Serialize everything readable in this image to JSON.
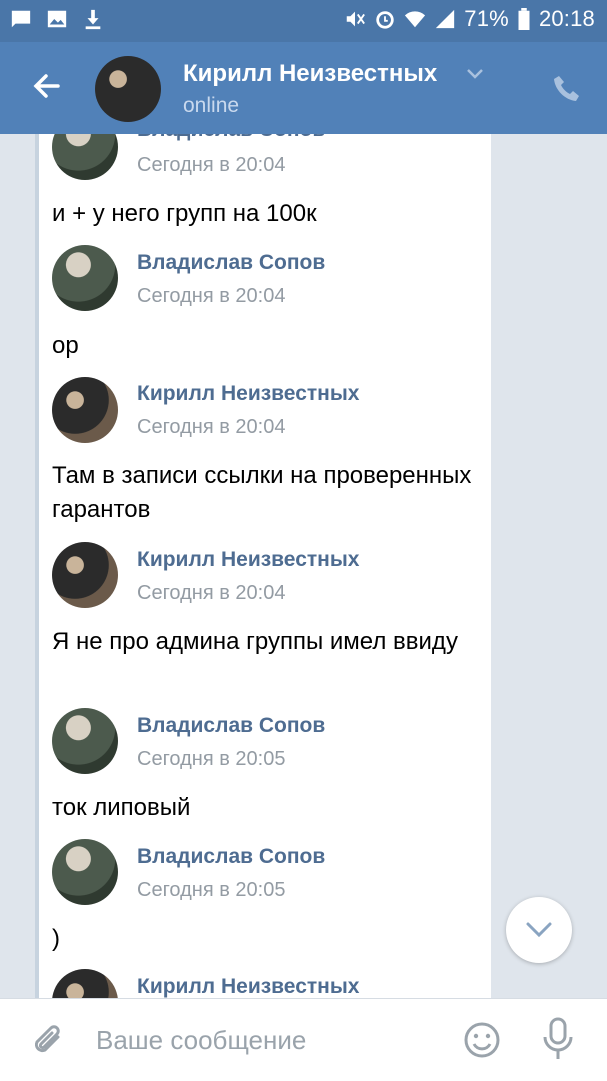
{
  "statusbar": {
    "battery_percent": "71%",
    "time": "20:18",
    "icons_left": [
      "message-icon",
      "image-icon",
      "download-icon"
    ],
    "icons_right": [
      "mute-icon",
      "alarm-icon",
      "wifi-icon",
      "signal-icon",
      "battery-icon"
    ]
  },
  "header": {
    "contact_name": "Кирилл Неизвестных",
    "status": "online"
  },
  "messages": [
    {
      "author": "Владислав Сопов",
      "time": "Сегодня в 20:04",
      "text": "и + у него групп на 100к"
    },
    {
      "author": "Владислав Сопов",
      "time": "Сегодня в 20:04",
      "text": "ор"
    },
    {
      "author": "Кирилл Неизвестных",
      "time": "Сегодня в 20:04",
      "text": "Там в записи ссылки на проверенных гарантов"
    },
    {
      "author": "Кирилл Неизвестных",
      "time": "Сегодня в 20:04",
      "text": "Я не про админа группы имел ввиду"
    },
    {
      "author": "Владислав Сопов",
      "time": "Сегодня в 20:05",
      "text": "ток липовый"
    },
    {
      "author": "Владислав Сопов",
      "time": "Сегодня в 20:05",
      "text": ")"
    },
    {
      "author": "Кирилл Неизвестных",
      "time": "",
      "text": ""
    }
  ],
  "composer": {
    "placeholder": "Ваше сообщение"
  },
  "colors": {
    "header_bg": "#5181b8",
    "statusbar_bg": "#4a76a8",
    "author": "#4e6c91",
    "time": "#939ba3",
    "chat_bg": "#dfe5ec"
  }
}
